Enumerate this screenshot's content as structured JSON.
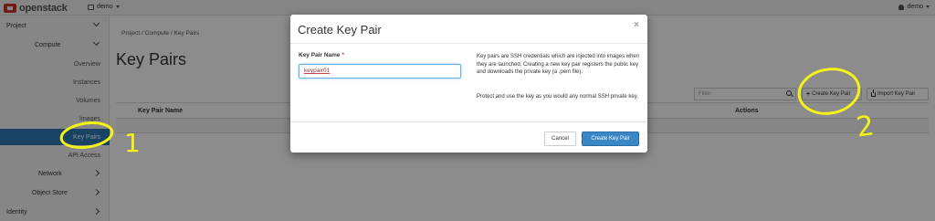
{
  "navbar": {
    "brand": "openstack",
    "project_switcher": "demo",
    "user": "demo"
  },
  "sidebar": {
    "items": [
      {
        "label": "Project"
      },
      {
        "label": "Compute"
      },
      {
        "label": "Overview"
      },
      {
        "label": "Instances"
      },
      {
        "label": "Volumes"
      },
      {
        "label": "Images"
      },
      {
        "label": "Key Pairs"
      },
      {
        "label": "API Access"
      },
      {
        "label": "Network"
      },
      {
        "label": "Object Store"
      },
      {
        "label": "Identity"
      }
    ]
  },
  "main": {
    "breadcrumb": "Project /  Compute /  Key Pairs",
    "title": "Key Pairs",
    "filter_placeholder": "Filter",
    "create_button": "Create Key Pair",
    "import_button": "Import Key Pair",
    "columns": [
      "Key Pair Name",
      "Actions"
    ]
  },
  "modal": {
    "title": "Create Key Pair",
    "close": "×",
    "field_label": "Key Pair Name",
    "required_mark": "*",
    "field_value": "keypair01",
    "help_1": "Key pairs are SSH credentials which are injected into images when they are launched. Creating a new key pair registers the public key and downloads the private key (a .pem file).",
    "help_2": "Protect and use the key as you would any normal SSH private key.",
    "cancel": "Cancel",
    "submit": "Create Key Pair"
  },
  "annotations": {
    "step_1": "1",
    "step_2": "2",
    "color": "#f2f21a"
  }
}
